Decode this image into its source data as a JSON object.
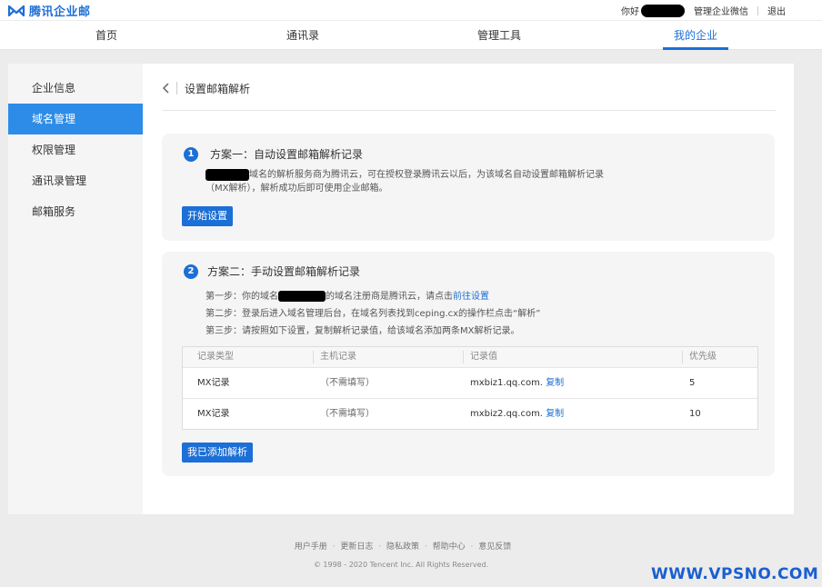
{
  "brand": {
    "name": "腾讯企业邮",
    "color": "#1c6fd6",
    "icon": "envelope-m-icon"
  },
  "topbar": {
    "greeting": "你好",
    "manage_link": "管理企业微信",
    "logout": "退出"
  },
  "nav": {
    "items": [
      "首页",
      "通讯录",
      "管理工具",
      "我的企业"
    ],
    "active_index": 3
  },
  "sidebar": {
    "items": [
      "企业信息",
      "域名管理",
      "权限管理",
      "通讯录管理",
      "邮箱服务"
    ],
    "active_index": 1
  },
  "page": {
    "title": "设置邮箱解析",
    "back_icon": "chevron-left-icon"
  },
  "plan1": {
    "number": "1",
    "title": "方案一：自动设置邮箱解析记录",
    "desc_line1": "域名的解析服务商为腾讯云，可在授权登录腾讯云以后，为该域名自动设置邮箱解析记录",
    "desc_line2": "（MX解析），解析成功后即可使用企业邮箱。",
    "button": "开始设置"
  },
  "plan2": {
    "number": "2",
    "title": "方案二：手动设置邮箱解析记录",
    "step1_prefix": "第一步：你的域名",
    "step1_suffix": "的域名注册商是腾讯云，请点击",
    "step1_link": "前往设置",
    "step2": "第二步：登录后进入域名管理后台，在域名列表找到ceping.cx的操作栏点击“解析”",
    "step3": "第三步：请按照如下设置，复制解析记录值，给该域名添加两条MX解析记录。",
    "table": {
      "headers": [
        "记录类型",
        "主机记录",
        "记录值",
        "优先级"
      ],
      "rows": [
        {
          "type": "MX记录",
          "host": "（不需填写）",
          "value": "mxbiz1.qq.com.",
          "copy": "复制",
          "priority": "5"
        },
        {
          "type": "MX记录",
          "host": "（不需填写）",
          "value": "mxbiz2.qq.com.",
          "copy": "复制",
          "priority": "10"
        }
      ]
    },
    "button": "我已添加解析"
  },
  "footer": {
    "links": [
      "用户手册",
      "更新日志",
      "隐私政策",
      "帮助中心",
      "意见反馈"
    ],
    "separator": "·",
    "copyright": "© 1998 - 2020 Tencent Inc. All Rights Reserved."
  },
  "watermark": "WWW.VPSNO.COM"
}
